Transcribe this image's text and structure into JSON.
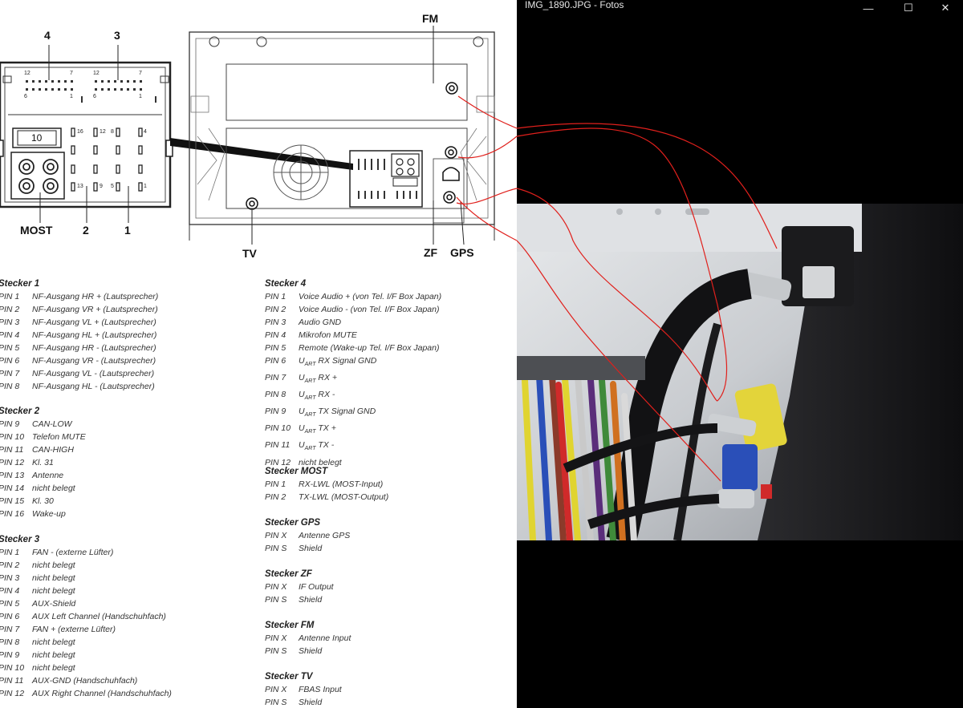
{
  "window": {
    "title": "IMG_1890.JPG - Fotos",
    "minimize": "—",
    "maximize": "☐",
    "close": "✕"
  },
  "diagram": {
    "connector_labels": {
      "c4": "4",
      "c3": "3",
      "most": "MOST",
      "c2": "2",
      "c1": "1",
      "fm": "FM",
      "tv": "TV",
      "zf": "ZF",
      "gps": "GPS"
    },
    "pin_numbers": {
      "a12": "12",
      "a7": "7",
      "a6": "6",
      "a1": "1",
      "b12": "12",
      "b7": "7",
      "b6": "6",
      "b1": "1",
      "p10": "10",
      "p16": "16",
      "p12": "12",
      "p8": "8",
      "p4": "4",
      "p13": "13",
      "p9": "9",
      "p5": "5",
      "p1": "1"
    }
  },
  "stecker1": {
    "title": "Stecker 1",
    "pins": [
      {
        "pin": "PIN  1",
        "desc": "NF-Ausgang HR + (Lautsprecher)"
      },
      {
        "pin": "PIN  2",
        "desc": "NF-Ausgang VR + (Lautsprecher)"
      },
      {
        "pin": "PIN  3",
        "desc": "NF-Ausgang VL + (Lautsprecher)"
      },
      {
        "pin": "PIN  4",
        "desc": "NF-Ausgang HL + (Lautsprecher)"
      },
      {
        "pin": "PIN  5",
        "desc": "NF-Ausgang HR - (Lautsprecher)"
      },
      {
        "pin": "PIN  6",
        "desc": "NF-Ausgang VR - (Lautsprecher)"
      },
      {
        "pin": "PIN  7",
        "desc": "NF-Ausgang VL - (Lautsprecher)"
      },
      {
        "pin": "PIN  8",
        "desc": "NF-Ausgang HL - (Lautsprecher)"
      }
    ]
  },
  "stecker2": {
    "title": "Stecker 2",
    "pins": [
      {
        "pin": "PIN  9",
        "desc": "CAN-LOW"
      },
      {
        "pin": "PIN 10",
        "desc": "Telefon MUTE"
      },
      {
        "pin": "PIN 11",
        "desc": "CAN-HIGH"
      },
      {
        "pin": "PIN 12",
        "desc": "Kl. 31"
      },
      {
        "pin": "PIN 13",
        "desc": "Antenne"
      },
      {
        "pin": "PIN 14",
        "desc": "nicht belegt"
      },
      {
        "pin": "PIN 15",
        "desc": "Kl. 30"
      },
      {
        "pin": "PIN 16",
        "desc": "Wake-up"
      }
    ]
  },
  "stecker3": {
    "title": "Stecker 3",
    "pins": [
      {
        "pin": "PIN  1",
        "desc": "FAN - (externe Lüfter)"
      },
      {
        "pin": "PIN  2",
        "desc": "nicht belegt"
      },
      {
        "pin": "PIN  3",
        "desc": "nicht belegt"
      },
      {
        "pin": "PIN  4",
        "desc": "nicht belegt"
      },
      {
        "pin": "PIN  5",
        "desc": "AUX-Shield"
      },
      {
        "pin": "PIN  6",
        "desc": "AUX Left Channel (Handschuhfach)"
      },
      {
        "pin": "PIN  7",
        "desc": "FAN + (externe Lüfter)"
      },
      {
        "pin": "PIN  8",
        "desc": "nicht belegt"
      },
      {
        "pin": "PIN  9",
        "desc": "nicht belegt"
      },
      {
        "pin": "PIN 10",
        "desc": "nicht belegt"
      },
      {
        "pin": "PIN 11",
        "desc": "AUX-GND (Handschuhfach)"
      },
      {
        "pin": "PIN 12",
        "desc": "AUX Right Channel (Handschuhfach)"
      }
    ]
  },
  "stecker4": {
    "title": "Stecker 4",
    "pins": [
      {
        "pin": "PIN  1",
        "desc": "Voice Audio + (von Tel. I/F Box Japan)"
      },
      {
        "pin": "PIN  2",
        "desc": "Voice Audio - (von Tel. I/F Box Japan)"
      },
      {
        "pin": "PIN  3",
        "desc": "Audio GND"
      },
      {
        "pin": "PIN  4",
        "desc": "Mikrofon MUTE"
      },
      {
        "pin": "PIN  5",
        "desc": "Remote (Wake-up Tel. I/F Box Japan)"
      },
      {
        "pin": "PIN  6",
        "desc": "U",
        "sub": "ART",
        "rest": " RX Signal GND"
      },
      {
        "pin": "PIN  7",
        "desc": "U",
        "sub": "ART",
        "rest": " RX +"
      },
      {
        "pin": "PIN  8",
        "desc": "U",
        "sub": "ART",
        "rest": " RX -"
      },
      {
        "pin": "PIN  9",
        "desc": "U",
        "sub": "ART",
        "rest": " TX Signal GND"
      },
      {
        "pin": "PIN 10",
        "desc": "U",
        "sub": "ART",
        "rest": " TX +"
      },
      {
        "pin": "PIN 11",
        "desc": "U",
        "sub": "ART",
        "rest": " TX -"
      },
      {
        "pin": "PIN 12",
        "desc": "nicht belegt"
      }
    ]
  },
  "stecker_most": {
    "title": "Stecker MOST",
    "pins": [
      {
        "pin": "PIN  1",
        "desc": "RX-LWL (MOST-Input)"
      },
      {
        "pin": "PIN  2",
        "desc": "TX-LWL (MOST-Output)"
      }
    ]
  },
  "stecker_gps": {
    "title": "Stecker GPS",
    "pins": [
      {
        "pin": "PIN  X",
        "desc": "Antenne GPS"
      },
      {
        "pin": "PIN  S",
        "desc": "Shield"
      }
    ]
  },
  "stecker_zf": {
    "title": "Stecker ZF",
    "pins": [
      {
        "pin": "PIN  X",
        "desc": "IF Output"
      },
      {
        "pin": "PIN  S",
        "desc": "Shield"
      }
    ]
  },
  "stecker_fm": {
    "title": "Stecker FM",
    "pins": [
      {
        "pin": "PIN  X",
        "desc": "Antenne Input"
      },
      {
        "pin": "PIN  S",
        "desc": "Shield"
      }
    ]
  },
  "stecker_tv": {
    "title": "Stecker TV",
    "pins": [
      {
        "pin": "PIN  X",
        "desc": "FBAS Input"
      },
      {
        "pin": "PIN  S",
        "desc": "Shield"
      }
    ]
  },
  "colors": {
    "annotation_red": "#e0201c",
    "window_bg": "#000000",
    "cable_yellow": "#e0d430",
    "cable_blue": "#2a4fb8"
  }
}
